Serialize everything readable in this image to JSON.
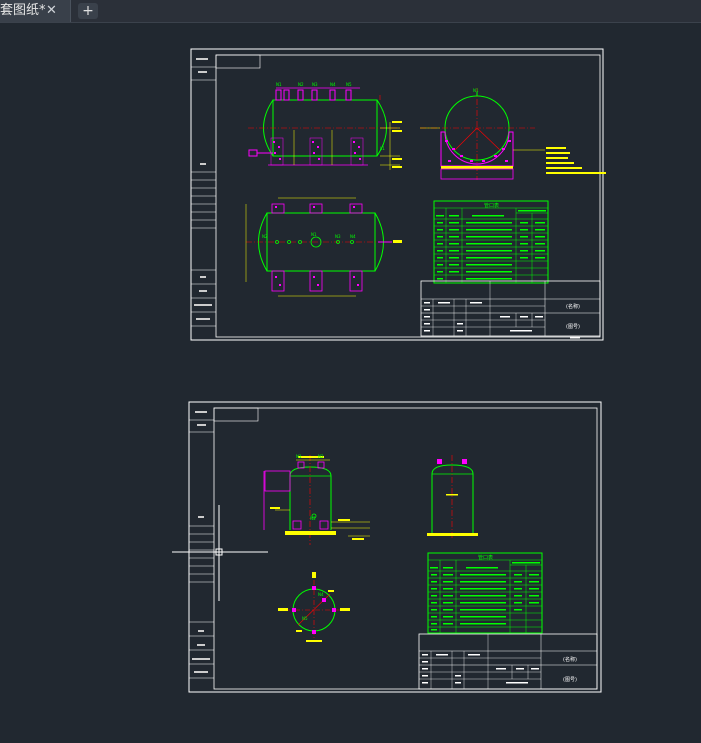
{
  "tab": {
    "title": "套图纸*",
    "close_glyph": "✕",
    "add_glyph": "+"
  },
  "icons": {
    "close": "close-icon",
    "add": "plus-icon",
    "crosshair": "crosshair-cursor-icon"
  },
  "colors": {
    "background": "#212830",
    "frame": "#ffffff",
    "vessel": "#00ff00",
    "centerline": "#ff0000",
    "nozzle": "#ff00ff",
    "dimension": "#ffff00"
  },
  "sheets": [
    {
      "name": "horizontal-tank-sheet",
      "table_title": "管口表",
      "nozzle_labels": [
        "N1",
        "N2",
        "N3",
        "N4",
        "N5",
        "L1"
      ],
      "title_block_right": [
        "(名称)",
        "(图号)"
      ]
    },
    {
      "name": "vertical-tank-sheet",
      "table_title": "管口表",
      "nozzle_labels": [
        "N1",
        "N2",
        "N3",
        "N4",
        "N5"
      ],
      "title_block_right": [
        "(名称)",
        "(图号)"
      ]
    }
  ]
}
